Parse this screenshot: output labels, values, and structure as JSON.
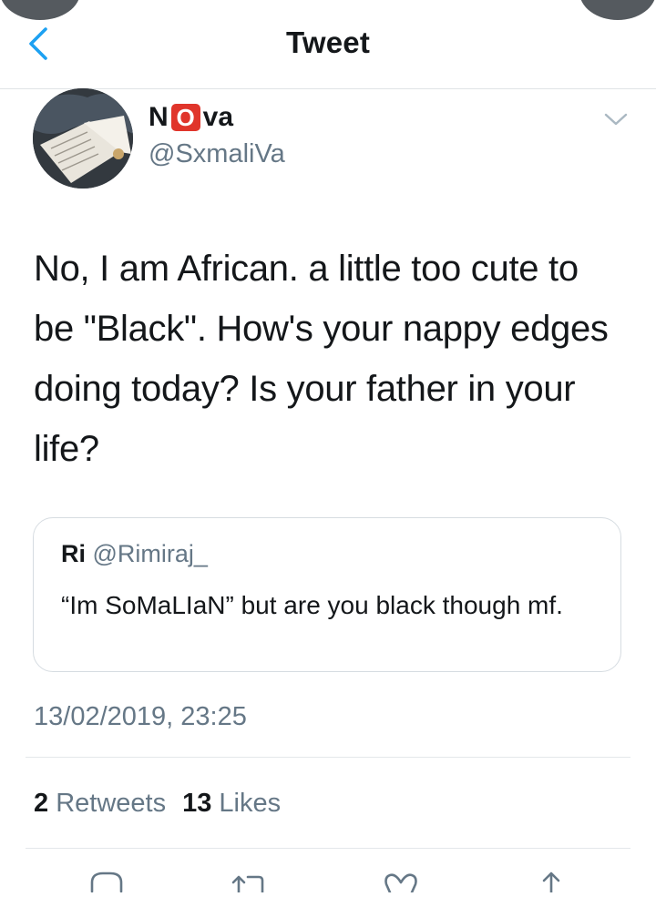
{
  "header": {
    "title": "Tweet"
  },
  "author": {
    "name_prefix": "N",
    "name_badge": "O",
    "name_suffix": "va",
    "handle": "@SxmaliVa"
  },
  "tweet": {
    "text": "No, I am African. a little too cute to be \"Black\". How's your nappy edges doing today? Is your father in your life?"
  },
  "quote": {
    "name": "Ri",
    "handle": "@Rimiraj_",
    "text": "“Im SoMaLIaN” but are you black though mf."
  },
  "timestamp": "13/02/2019, 23:25",
  "stats": {
    "retweets_count": "2",
    "retweets_label": "Retweets",
    "likes_count": "13",
    "likes_label": "Likes"
  },
  "icons": [
    "chevron-left-icon",
    "chevron-down-icon",
    "reply-icon",
    "retweet-icon",
    "heart-icon",
    "share-icon"
  ],
  "colors": {
    "accent": "#1da1f2",
    "badge": "#e0352b",
    "secondary_text": "#657786"
  }
}
